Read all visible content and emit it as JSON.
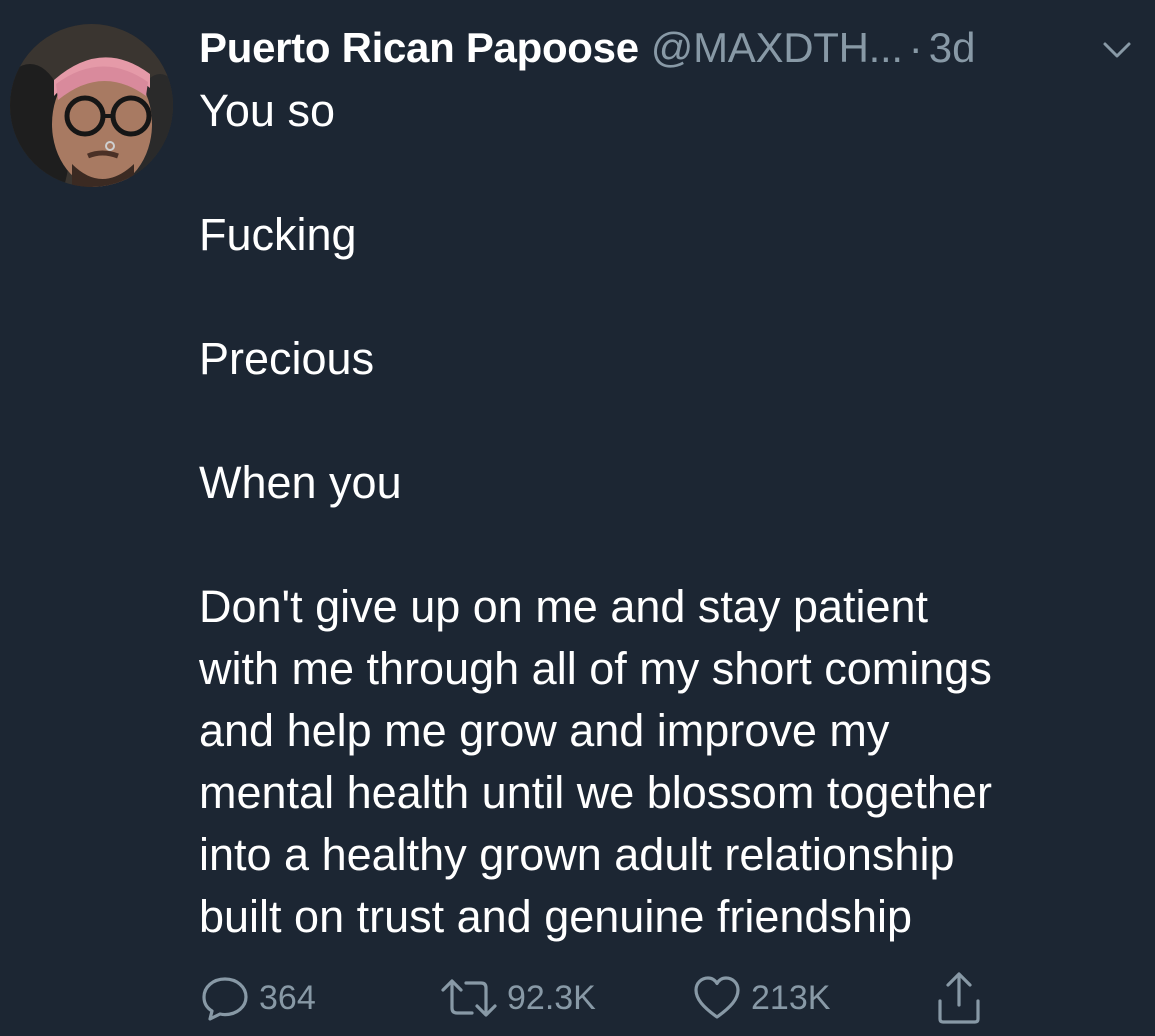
{
  "tweet": {
    "display_name": "Puerto Rican Papoose",
    "handle": "@MAXDTH...",
    "separator": "·",
    "time": "3d",
    "body": {
      "line1": "You so",
      "line2": "Fucking",
      "line3": "Precious",
      "line4": "When you",
      "para": [
        "Don't give up on me and stay patient",
        "with me through all of my short comings",
        "and help me grow and improve my",
        "mental health until we blossom together",
        "into a healthy grown adult relationship",
        "built on trust and genuine friendship"
      ]
    },
    "actions": {
      "replies": "364",
      "retweets": "92.3K",
      "likes": "213K"
    },
    "icons": {
      "reply": "reply-icon",
      "retweet": "retweet-icon",
      "like": "heart-icon",
      "share": "share-icon",
      "menu": "chevron-down-icon"
    },
    "colors": {
      "background": "#1c2633",
      "text": "#ffffff",
      "muted": "#8899a6"
    }
  }
}
